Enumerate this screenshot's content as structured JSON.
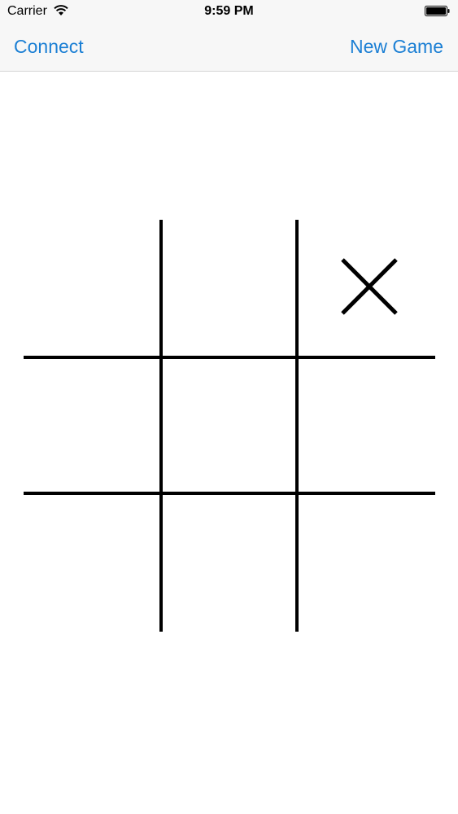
{
  "status_bar": {
    "carrier": "Carrier",
    "time": "9:59 PM",
    "wifi_icon": "wifi-icon",
    "battery_icon": "battery-icon"
  },
  "nav": {
    "left_label": "Connect",
    "right_label": "New Game"
  },
  "colors": {
    "accent": "#1b7fd4",
    "bar_background": "#f7f7f7",
    "board_lines": "#000000"
  },
  "board": {
    "cells": [
      "",
      "",
      "X",
      "",
      "",
      "",
      "",
      "",
      ""
    ]
  }
}
